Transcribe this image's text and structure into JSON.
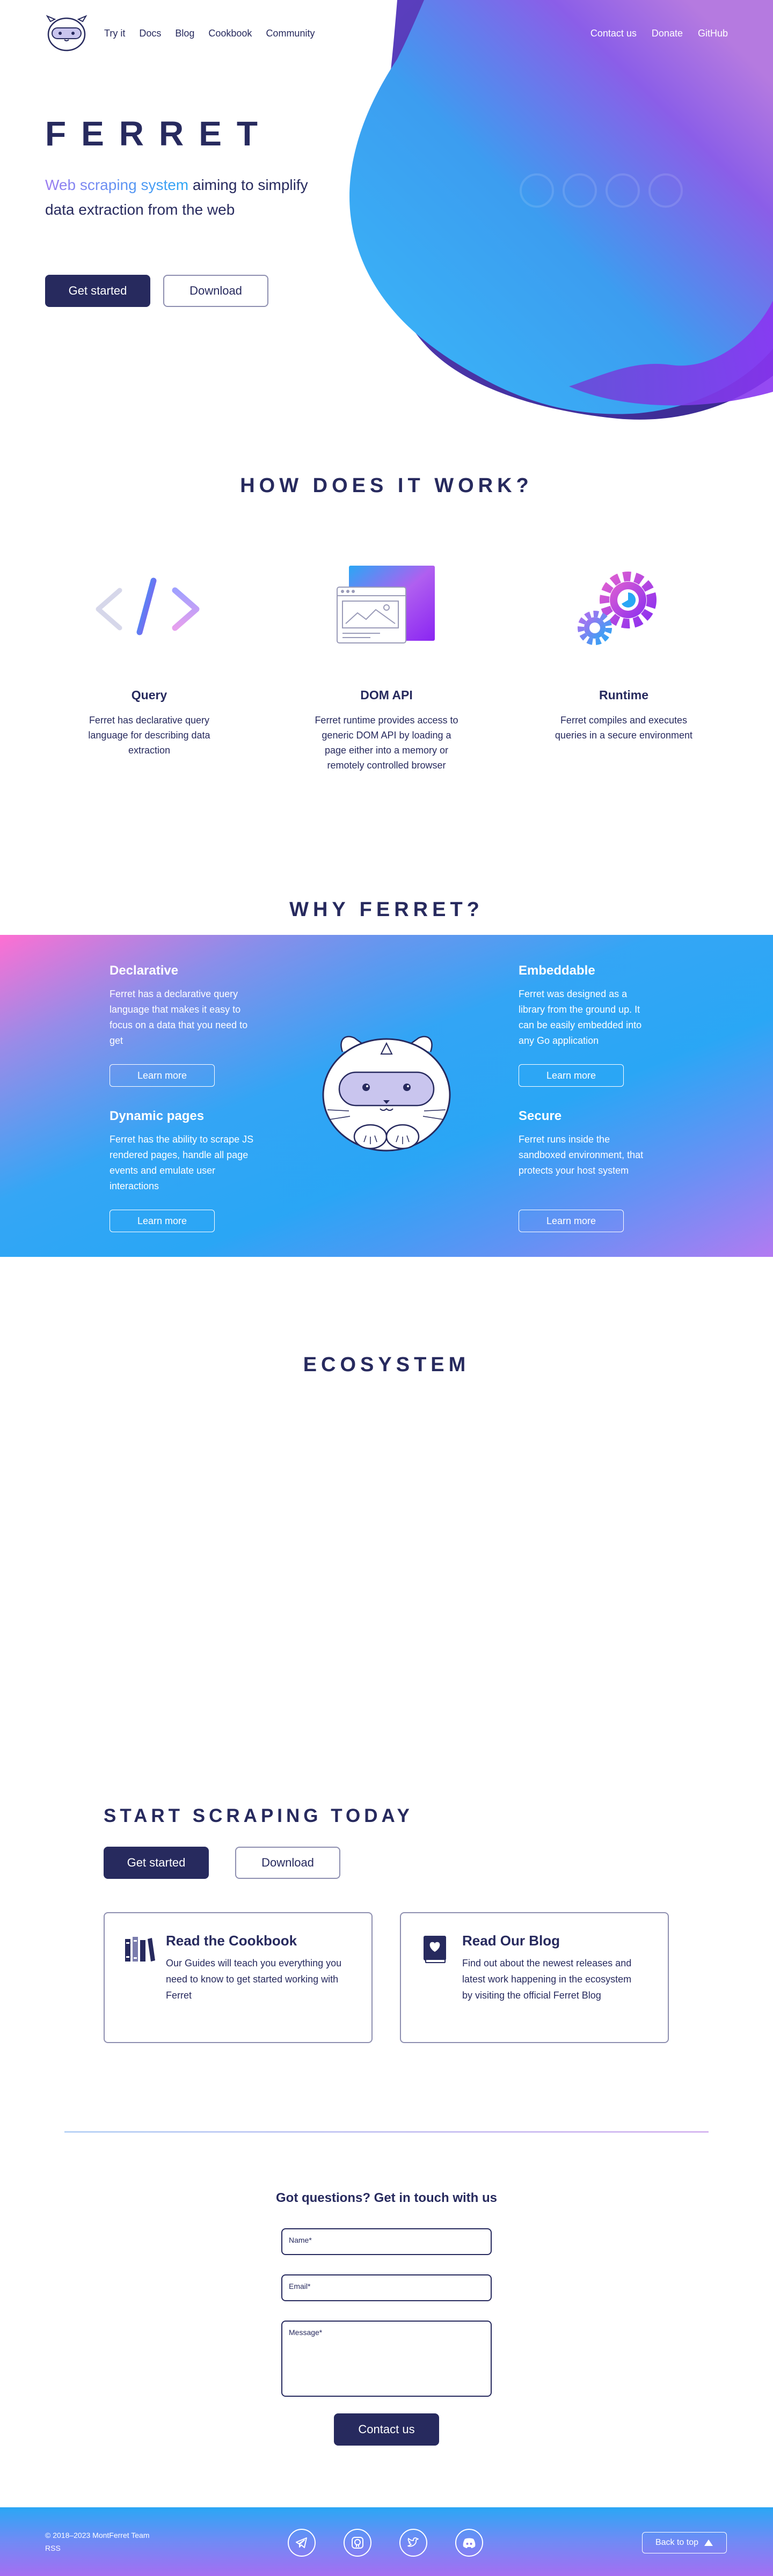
{
  "header": {
    "logo_alt": "ferret-logo",
    "nav_left": [
      "Try it",
      "Docs",
      "Blog",
      "Cookbook",
      "Community"
    ],
    "nav_right": [
      "Contact us",
      "Donate",
      "GitHub"
    ]
  },
  "hero": {
    "title": "FERRET",
    "tagline_highlight": "Web scraping system",
    "tagline_rest_1": " aiming to simplify",
    "tagline_rest_2": "data extraction from the web",
    "get_started": "Get started",
    "download": "Download"
  },
  "how": {
    "title": "HOW DOES IT WORK?",
    "items": [
      {
        "title": "Query",
        "desc": "Ferret has declarative query language for describing data extraction",
        "icon": "code-brackets-icon"
      },
      {
        "title": "DOM API",
        "desc": "Ferret runtime provides access to generic DOM API by loading a page either into a memory or remotely controlled browser",
        "icon": "browser-window-icon"
      },
      {
        "title": "Runtime",
        "desc": "Ferret compiles and executes queries in a secure environment",
        "icon": "gears-icon"
      }
    ]
  },
  "why": {
    "title": "WHY FERRET?",
    "items": [
      {
        "title": "Declarative",
        "desc": "Ferret has a declarative query language that makes it easy to focus on a data that you need to get",
        "button": "Learn more"
      },
      {
        "title": "Embeddable",
        "desc": "Ferret was designed as a library from the ground up. It can be easily embedded into any Go application",
        "button": "Learn more"
      },
      {
        "title": "Dynamic pages",
        "desc": "Ferret has the ability to scrape JS rendered pages, handle all page events and emulate user interactions",
        "button": "Learn more"
      },
      {
        "title": "Secure",
        "desc": "Ferret runs inside the sandboxed environment, that protects your host system",
        "button": "Learn more"
      }
    ]
  },
  "ecosystem": {
    "title": "ECOSYSTEM"
  },
  "start": {
    "title": "START SCRAPING TODAY",
    "get_started": "Get started",
    "download": "Download",
    "cards": [
      {
        "title": "Read the Cookbook",
        "desc": "Our Guides will teach you everything you need to know to get started working with Ferret",
        "icon": "books-icon"
      },
      {
        "title": "Read Our Blog",
        "desc": "Find out about the newest releases and latest work happening in the ecosystem by visiting the official Ferret Blog",
        "icon": "heart-book-icon"
      }
    ]
  },
  "contact": {
    "title": "Got questions? Get in touch with us",
    "name_label": "Name*",
    "email_label": "Email*",
    "message_label": "Message*",
    "submit": "Contact us"
  },
  "footer": {
    "copyright": "© 2018–2023 MontFerret Team",
    "rss": "RSS",
    "socials": [
      "telegram-icon",
      "github-icon",
      "twitter-icon",
      "discord-icon"
    ],
    "back_to_top": "Back to top"
  },
  "colors": {
    "navy": "#272a5e",
    "blue": "#2aa7f5",
    "purple": "#8a46f0",
    "pink": "#f070d0"
  }
}
